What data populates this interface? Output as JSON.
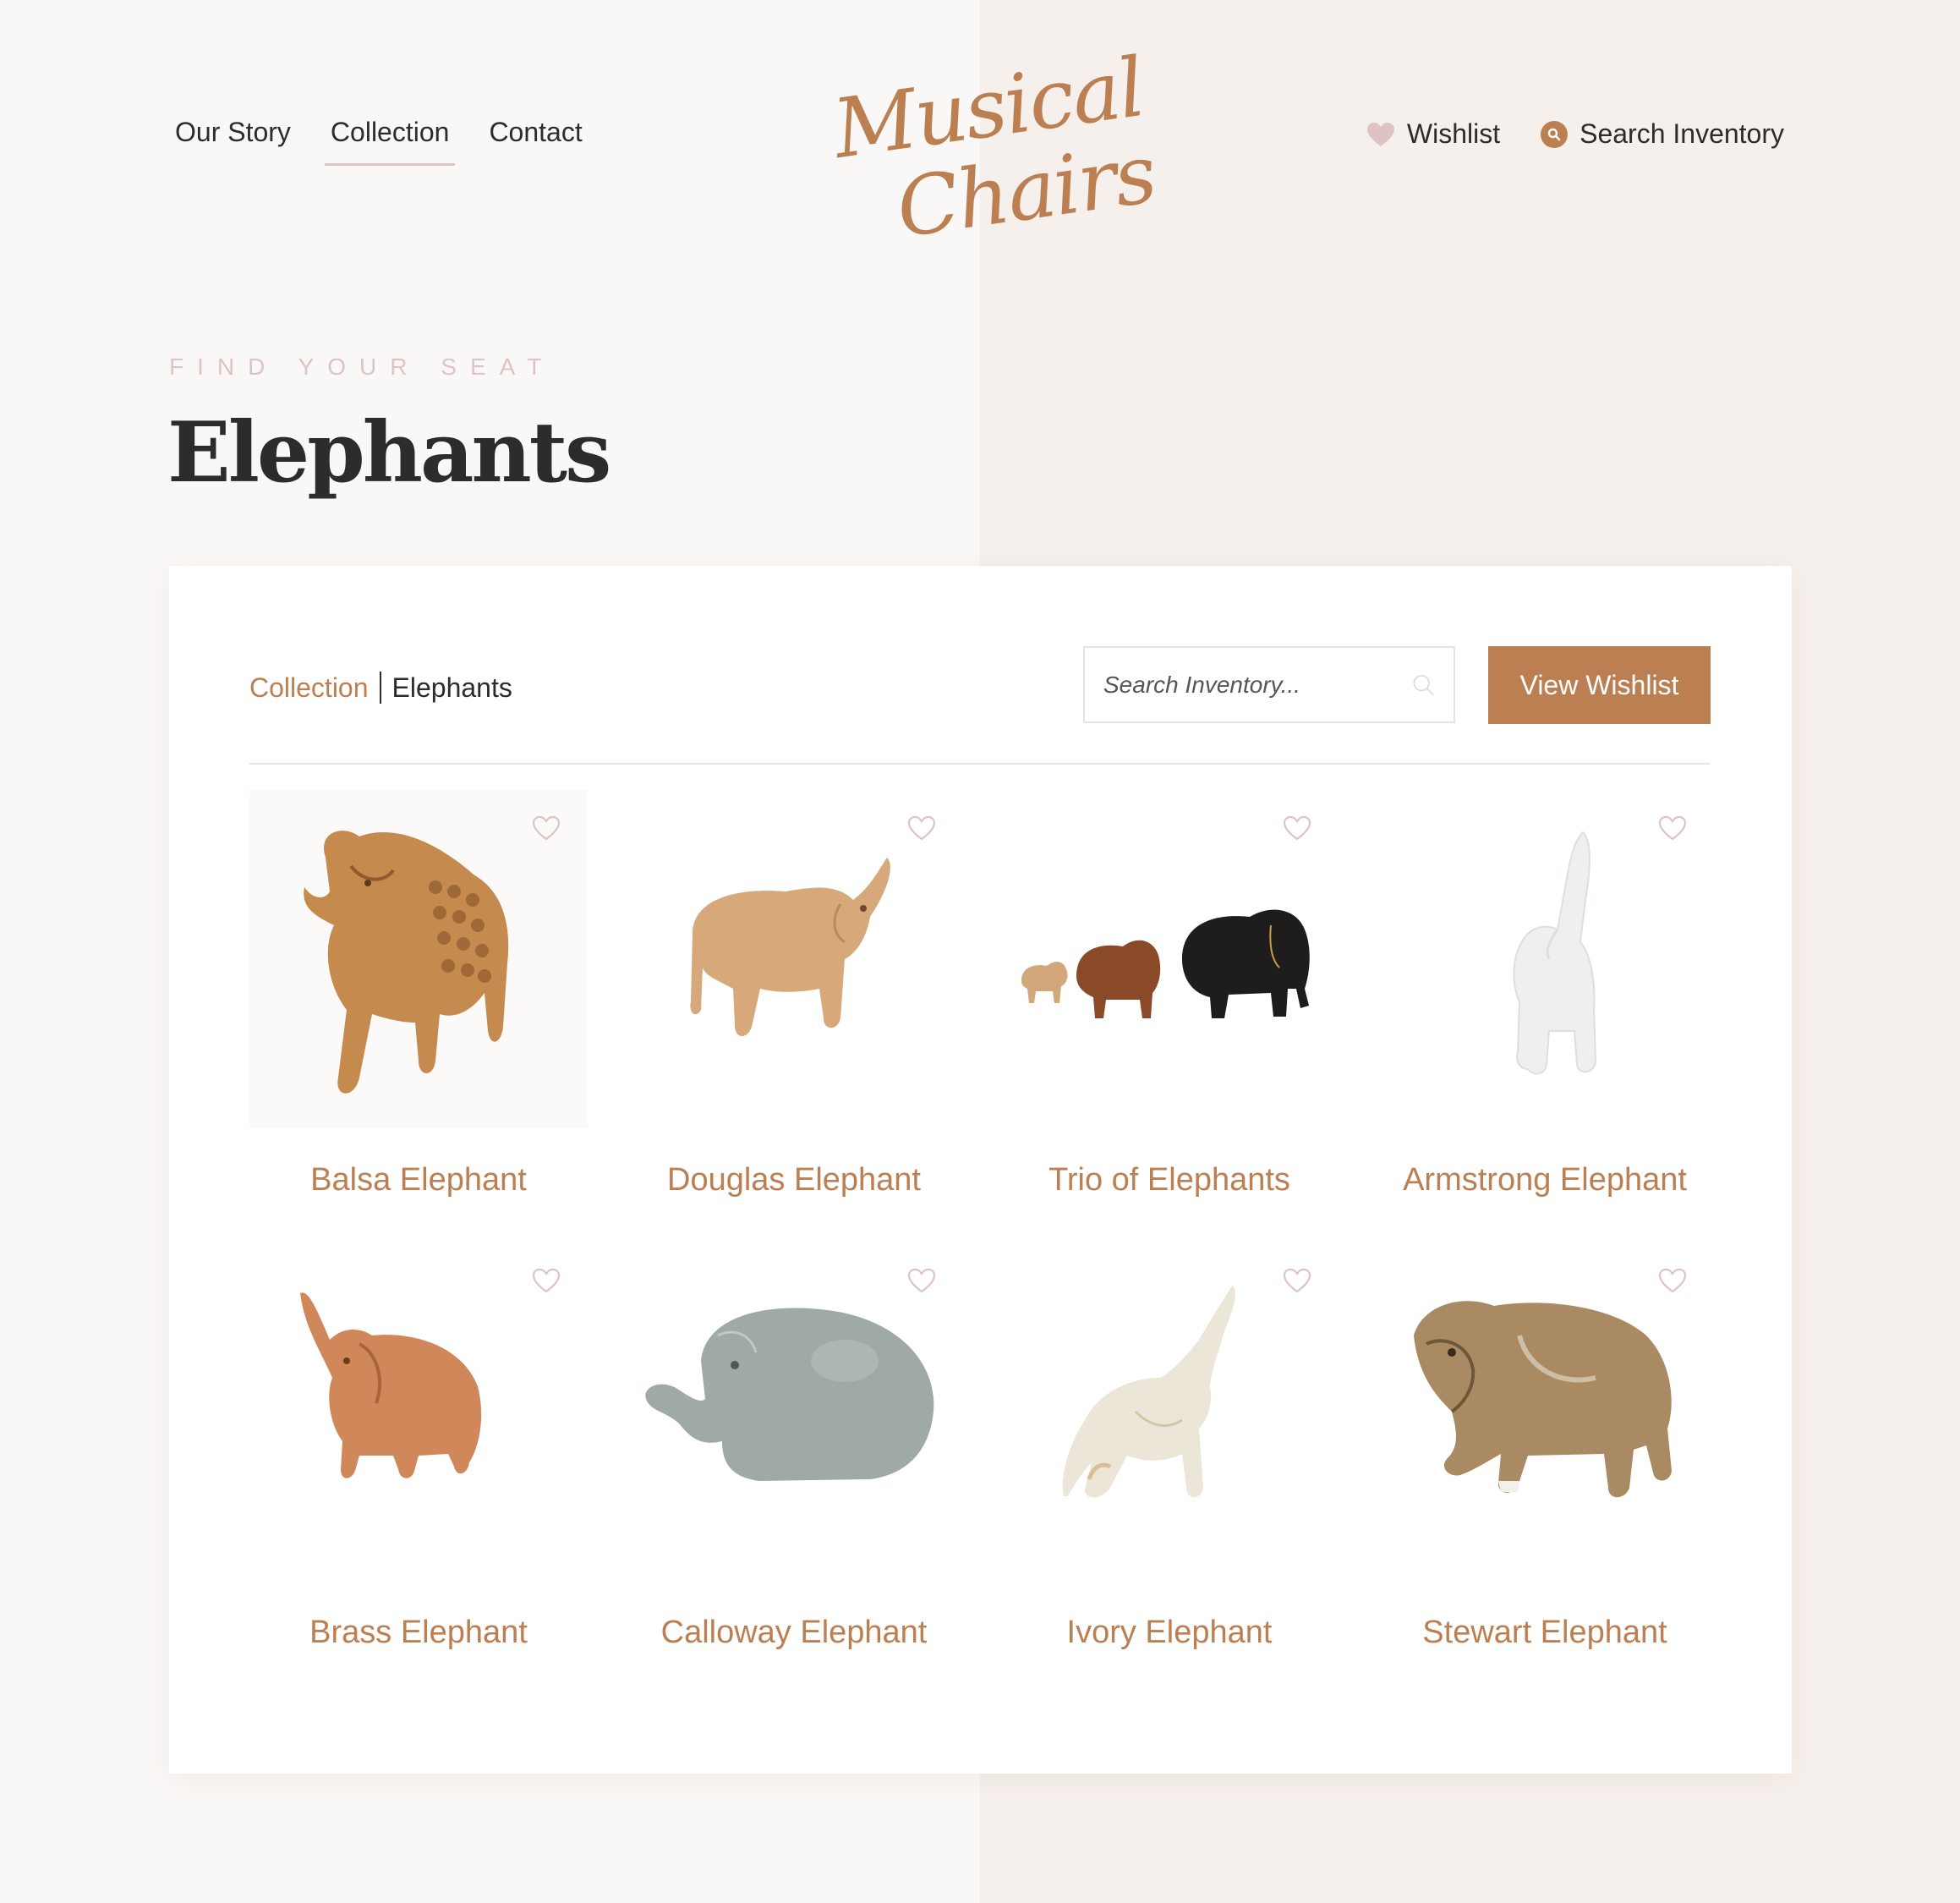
{
  "nav": {
    "left": [
      {
        "label": "Our Story",
        "active": false
      },
      {
        "label": "Collection",
        "active": true
      },
      {
        "label": "Contact",
        "active": false
      }
    ],
    "right": {
      "wishlist_label": "Wishlist",
      "search_label": "Search Inventory"
    }
  },
  "logo": {
    "line1": "Musical",
    "line2": "Chairs"
  },
  "hero": {
    "eyebrow": "FIND YOUR SEAT",
    "title": "Elephants"
  },
  "breadcrumb": {
    "parent": "Collection",
    "current": "Elephants"
  },
  "search": {
    "placeholder": "Search Inventory..."
  },
  "wishlist_button": "View Wishlist",
  "products": [
    {
      "name": "Balsa Elephant",
      "icon": "carved-wood-elephant"
    },
    {
      "name": "Douglas Elephant",
      "icon": "light-wood-elephant"
    },
    {
      "name": "Trio of Elephants",
      "icon": "three-elephants"
    },
    {
      "name": "Armstrong Elephant",
      "icon": "white-ceramic-elephant"
    },
    {
      "name": "Brass Elephant",
      "icon": "copper-elephant"
    },
    {
      "name": "Calloway Elephant",
      "icon": "glass-elephant"
    },
    {
      "name": "Ivory Elephant",
      "icon": "onyx-elephant"
    },
    {
      "name": "Stewart Elephant",
      "icon": "glazed-ceramic-elephant"
    }
  ],
  "colors": {
    "accent": "#bb7f52",
    "heart_pink": "#dfc3c4",
    "text": "#2e2c2a",
    "bg_left": "#faf8f6",
    "bg_right": "#f6f0ec"
  }
}
